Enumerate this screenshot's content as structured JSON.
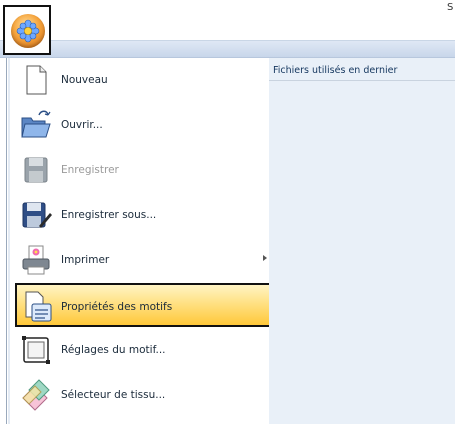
{
  "titlebar": {
    "edge_text": "S"
  },
  "app_button": {
    "icon": "flower-orb-icon"
  },
  "menu": {
    "items": [
      {
        "label": "Nouveau",
        "icon": "new-document-icon",
        "enabled": true
      },
      {
        "label": "Ouvrir...",
        "icon": "open-folder-icon",
        "enabled": true
      },
      {
        "label": "Enregistrer",
        "icon": "save-icon",
        "enabled": false
      },
      {
        "label": "Enregistrer sous...",
        "icon": "save-as-icon",
        "enabled": true
      },
      {
        "label": "Imprimer",
        "icon": "print-icon",
        "enabled": true,
        "submenu": true
      },
      {
        "label": "Propriétés des motifs",
        "icon": "design-properties-icon",
        "enabled": true,
        "highlighted": true
      },
      {
        "label": "Réglages du motif...",
        "icon": "design-settings-icon",
        "enabled": true
      },
      {
        "label": "Sélecteur de tissu...",
        "icon": "fabric-selector-icon",
        "enabled": true
      }
    ]
  },
  "recent": {
    "header": "Fichiers utilisés en dernier"
  },
  "colors": {
    "highlight": "#ffc83a",
    "panel": "#e9f0f8",
    "ribbon": "#c8d6ea"
  }
}
